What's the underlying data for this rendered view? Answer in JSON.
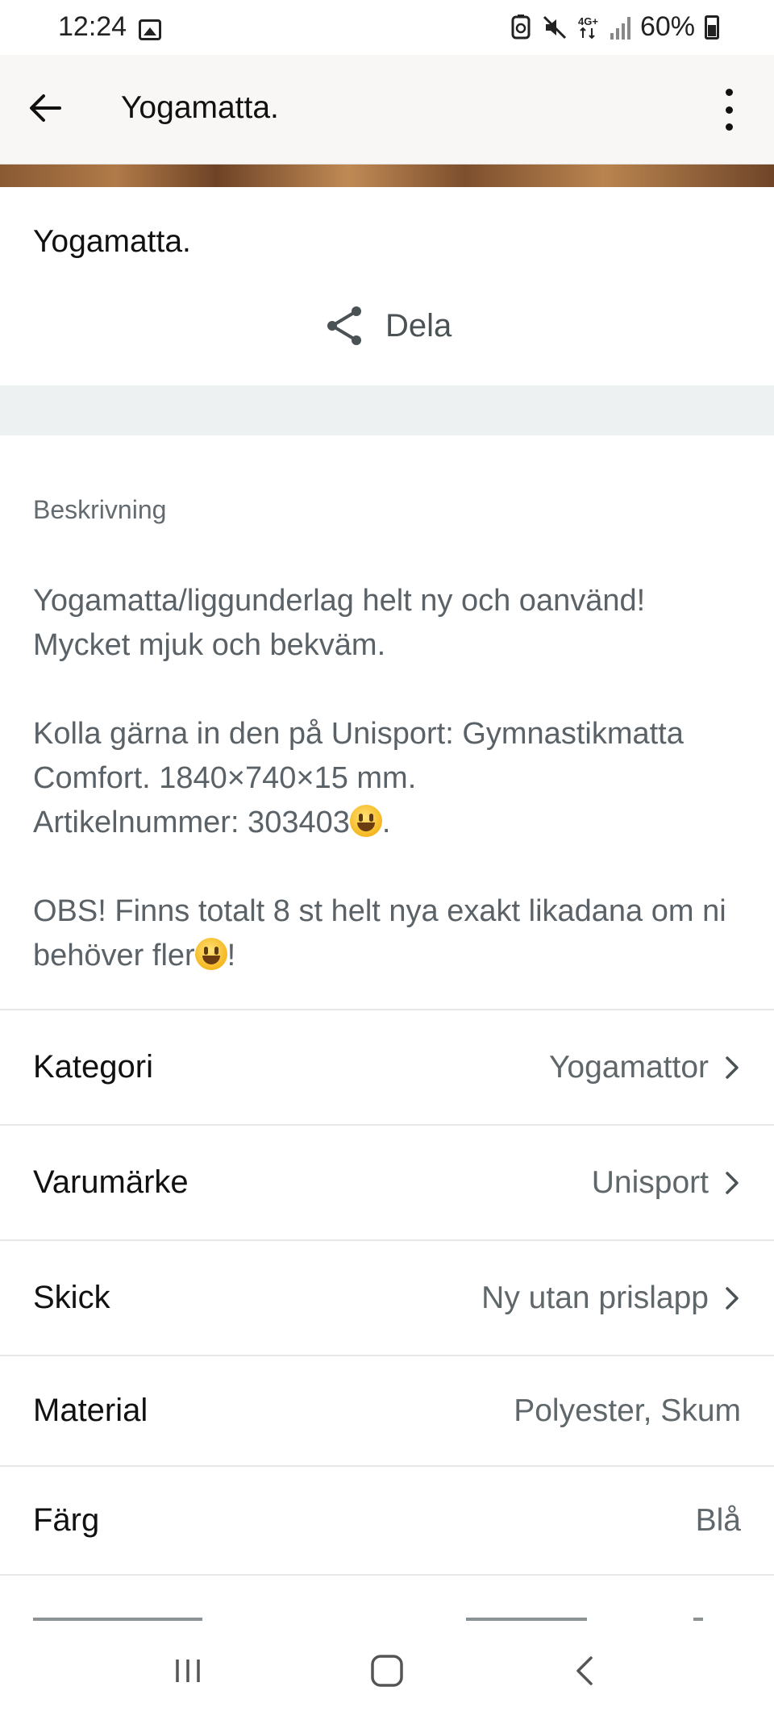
{
  "status_bar": {
    "time": "12:24",
    "network": "4G+",
    "battery": "60%"
  },
  "app_bar": {
    "title": "Yogamatta."
  },
  "item": {
    "title": "Yogamatta.",
    "share_label": "Dela"
  },
  "description": {
    "label": "Beskrivning",
    "paragraphs": [
      "Yogamatta/liggunderlag helt ny och oanvänd!\nMycket mjuk och bekväm.",
      "Kolla gärna in den på Unisport: Gymnastikmatta Comfort. 1840×740×15 mm.",
      "Artikelnummer: 303403",
      ".",
      "OBS! Finns totalt 8 st helt nya exakt likadana om ni behöver fler",
      "!"
    ]
  },
  "attributes": [
    {
      "label": "Kategori",
      "value": "Yogamattor",
      "has_link": true
    },
    {
      "label": "Varumärke",
      "value": "Unisport",
      "has_link": true
    },
    {
      "label": "Skick",
      "value": "Ny utan prislapp",
      "has_link": true
    },
    {
      "label": "Material",
      "value": "Polyester, Skum",
      "has_link": false
    },
    {
      "label": "Färg",
      "value": "Blå",
      "has_link": false
    }
  ],
  "icons": {
    "back": "arrow-left-icon",
    "more": "more-vertical-icon",
    "share": "share-icon",
    "chevron": "chevron-right-icon",
    "nav_recents": "recents-icon",
    "nav_home": "home-icon",
    "nav_back": "nav-back-icon"
  },
  "colors": {
    "app_bar_bg": "#f9f7f5",
    "divider_band": "#edf1f2",
    "secondary_text": "#5f676b"
  }
}
